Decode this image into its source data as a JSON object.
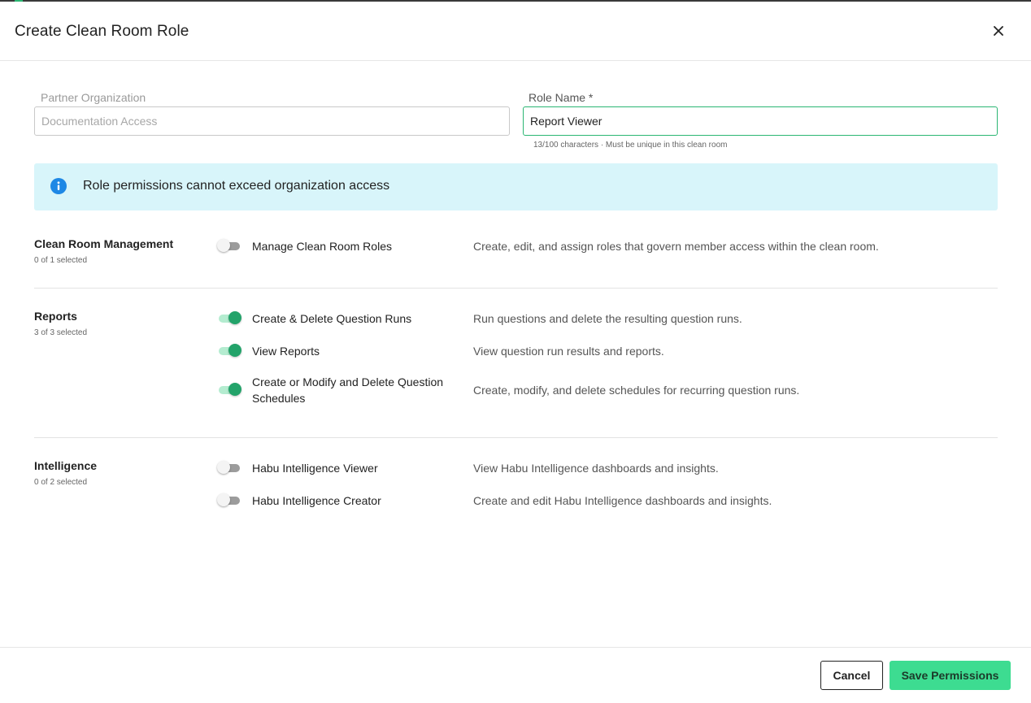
{
  "modal": {
    "title": "Create Clean Room Role"
  },
  "form": {
    "partner_label": "Partner Organization",
    "partner_placeholder": "Documentation Access",
    "role_label": "Role Name *",
    "role_value": "Report Viewer",
    "role_helper": "13/100 characters · Must be unique in this clean room"
  },
  "banner": {
    "message": "Role permissions cannot exceed organization access"
  },
  "sections": [
    {
      "title": "Clean Room Management",
      "count": "0 of 1 selected",
      "permissions": [
        {
          "name": "Manage Clean Room Roles",
          "description": "Create, edit, and assign roles that govern member access within the clean room.",
          "enabled": false
        }
      ]
    },
    {
      "title": "Reports",
      "count": "3 of 3 selected",
      "permissions": [
        {
          "name": "Create & Delete Question Runs",
          "description": "Run questions and delete the resulting question runs.",
          "enabled": true
        },
        {
          "name": "View Reports",
          "description": "View question run results and reports.",
          "enabled": true
        },
        {
          "name": "Create or Modify and Delete Question Schedules",
          "description": "Create, modify, and delete schedules for recurring question runs.",
          "enabled": true
        }
      ]
    },
    {
      "title": "Intelligence",
      "count": "0 of 2 selected",
      "permissions": [
        {
          "name": "Habu Intelligence Viewer",
          "description": "View Habu Intelligence dashboards and insights.",
          "enabled": false
        },
        {
          "name": "Habu Intelligence Creator",
          "description": "Create and edit Habu Intelligence dashboards and insights.",
          "enabled": false
        }
      ]
    }
  ],
  "footer": {
    "cancel_label": "Cancel",
    "save_label": "Save Permissions"
  },
  "colors": {
    "accent": "#3ddc91",
    "toggle_on": "#23a36a",
    "banner_bg": "#d8f5fa",
    "info_icon": "#1e88e5"
  }
}
